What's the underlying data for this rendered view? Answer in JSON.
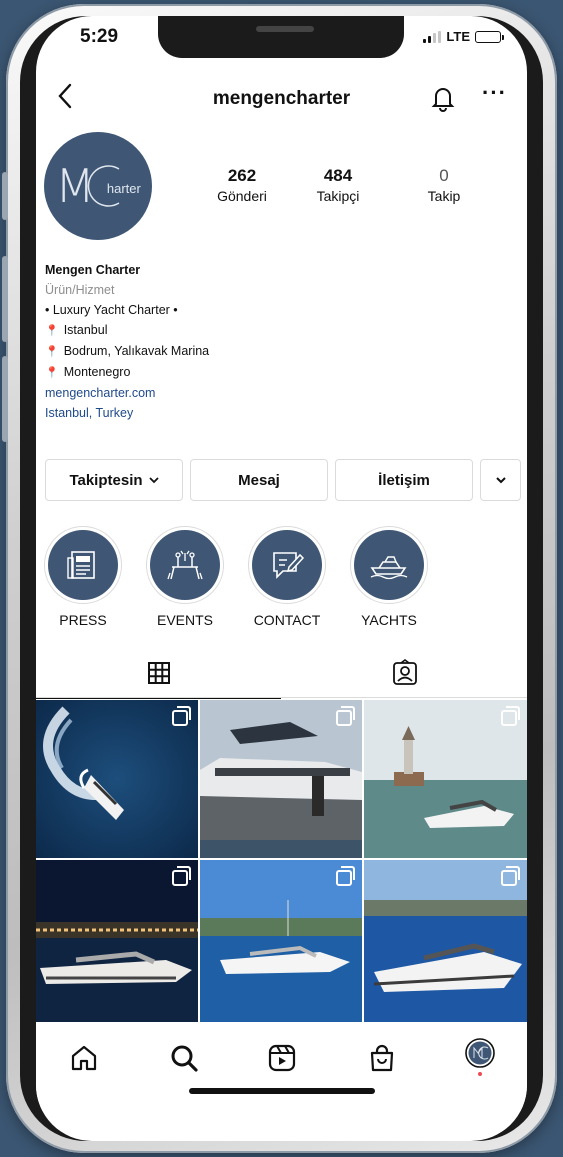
{
  "status": {
    "time": "5:29",
    "network": "LTE"
  },
  "header": {
    "username": "mengencharter"
  },
  "profile": {
    "avatar_text": "M",
    "avatar_sub": "harter",
    "stats": [
      {
        "value": "262",
        "label": "Gönderi"
      },
      {
        "value": "484",
        "label": "Takipçi"
      },
      {
        "value": "0",
        "label": "Takip"
      }
    ]
  },
  "bio": {
    "name": "Mengen Charter",
    "category": "Ürün/Hizmet",
    "line1": "• Luxury Yacht Charter •",
    "loc1": "Istanbul",
    "loc2": "Bodrum, Yalıkavak Marina",
    "loc3": "Montenegro",
    "website": "mengencharter.com",
    "city": "Istanbul, Turkey"
  },
  "actions": {
    "follow": "Takiptesin",
    "message": "Mesaj",
    "contact": "İletişim"
  },
  "highlights": [
    {
      "label": "PRESS",
      "icon": "newspaper-icon"
    },
    {
      "label": "EVENTS",
      "icon": "event-table-icon"
    },
    {
      "label": "CONTACT",
      "icon": "note-pen-icon"
    },
    {
      "label": "YACHTS",
      "icon": "yacht-icon"
    }
  ],
  "tabs": [
    {
      "icon": "grid-icon"
    },
    {
      "icon": "tagged-icon"
    }
  ],
  "nav": [
    {
      "icon": "home-icon"
    },
    {
      "icon": "search-icon"
    },
    {
      "icon": "reels-icon"
    },
    {
      "icon": "shop-icon"
    },
    {
      "icon": "profile-avatar"
    }
  ],
  "colors": {
    "brand": "#3f5775",
    "background": "#3b5672",
    "link": "#1e4a8a"
  }
}
